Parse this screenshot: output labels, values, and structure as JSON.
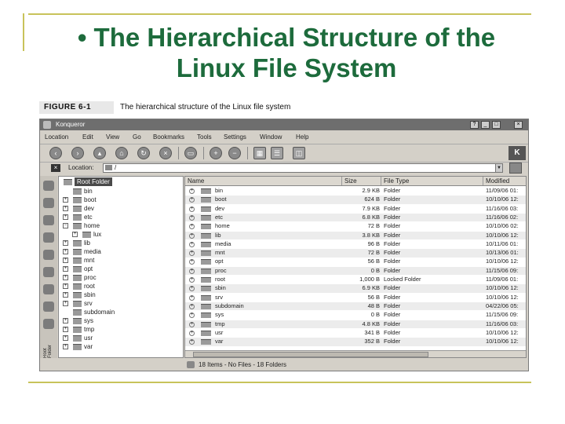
{
  "slide": {
    "title_line1": "• The Hierarchical Structure of the",
    "title_line2": "Linux File System"
  },
  "figure": {
    "label": "FIGURE 6-1",
    "caption": "The hierarchical structure of the Linux file system"
  },
  "window": {
    "title": "Konqueror",
    "controls": [
      "?",
      "_",
      "□",
      "×"
    ]
  },
  "menu": [
    "Location",
    "Edit",
    "View",
    "Go",
    "Bookmarks",
    "Tools",
    "Settings",
    "Window",
    "Help"
  ],
  "location": {
    "label": "Location:",
    "value": "/",
    "clear_icon": "clear-location-icon"
  },
  "toolbar": {
    "logo": "K"
  },
  "sidebar": {
    "tab_label": "Root Folder"
  },
  "tree": {
    "root": "Root Folder",
    "items": [
      "bin",
      "boot",
      "dev",
      "etc",
      "home",
      "lux",
      "lib",
      "media",
      "mnt",
      "opt",
      "proc",
      "root",
      "sbin",
      "srv",
      "subdomain",
      "sys",
      "tmp",
      "usr",
      "var"
    ]
  },
  "filelist": {
    "columns": [
      "Name",
      "Size",
      "File Type",
      "Modified"
    ],
    "rows": [
      {
        "name": "bin",
        "size": "2.9 KB",
        "type": "Folder",
        "modified": "11/09/06 01:"
      },
      {
        "name": "boot",
        "size": "624 B",
        "type": "Folder",
        "modified": "10/10/06 12:"
      },
      {
        "name": "dev",
        "size": "7.9 KB",
        "type": "Folder",
        "modified": "11/16/06 03:"
      },
      {
        "name": "etc",
        "size": "6.8 KB",
        "type": "Folder",
        "modified": "11/16/06 02:"
      },
      {
        "name": "home",
        "size": "72 B",
        "type": "Folder",
        "modified": "10/10/06 02:"
      },
      {
        "name": "lib",
        "size": "3.8 KB",
        "type": "Folder",
        "modified": "10/10/06 12:"
      },
      {
        "name": "media",
        "size": "96 B",
        "type": "Folder",
        "modified": "10/11/06 01:"
      },
      {
        "name": "mnt",
        "size": "72 B",
        "type": "Folder",
        "modified": "10/13/06 01:"
      },
      {
        "name": "opt",
        "size": "56 B",
        "type": "Folder",
        "modified": "10/10/06 12:"
      },
      {
        "name": "proc",
        "size": "0 B",
        "type": "Folder",
        "modified": "11/15/06 09:"
      },
      {
        "name": "root",
        "size": "1,000 B",
        "type": "Locked Folder",
        "modified": "11/09/06 01:"
      },
      {
        "name": "sbin",
        "size": "6.9 KB",
        "type": "Folder",
        "modified": "10/10/06 12:"
      },
      {
        "name": "srv",
        "size": "56 B",
        "type": "Folder",
        "modified": "10/10/06 12:"
      },
      {
        "name": "subdomain",
        "size": "48 B",
        "type": "Folder",
        "modified": "04/22/06 05:"
      },
      {
        "name": "sys",
        "size": "0 B",
        "type": "Folder",
        "modified": "11/15/06 09:"
      },
      {
        "name": "tmp",
        "size": "4.8 KB",
        "type": "Folder",
        "modified": "11/16/06 03:"
      },
      {
        "name": "usr",
        "size": "341 B",
        "type": "Folder",
        "modified": "10/10/06 12:"
      },
      {
        "name": "var",
        "size": "352 B",
        "type": "Folder",
        "modified": "10/10/06 12:"
      }
    ]
  },
  "status": {
    "text": "18 Items - No Files - 18 Folders"
  }
}
